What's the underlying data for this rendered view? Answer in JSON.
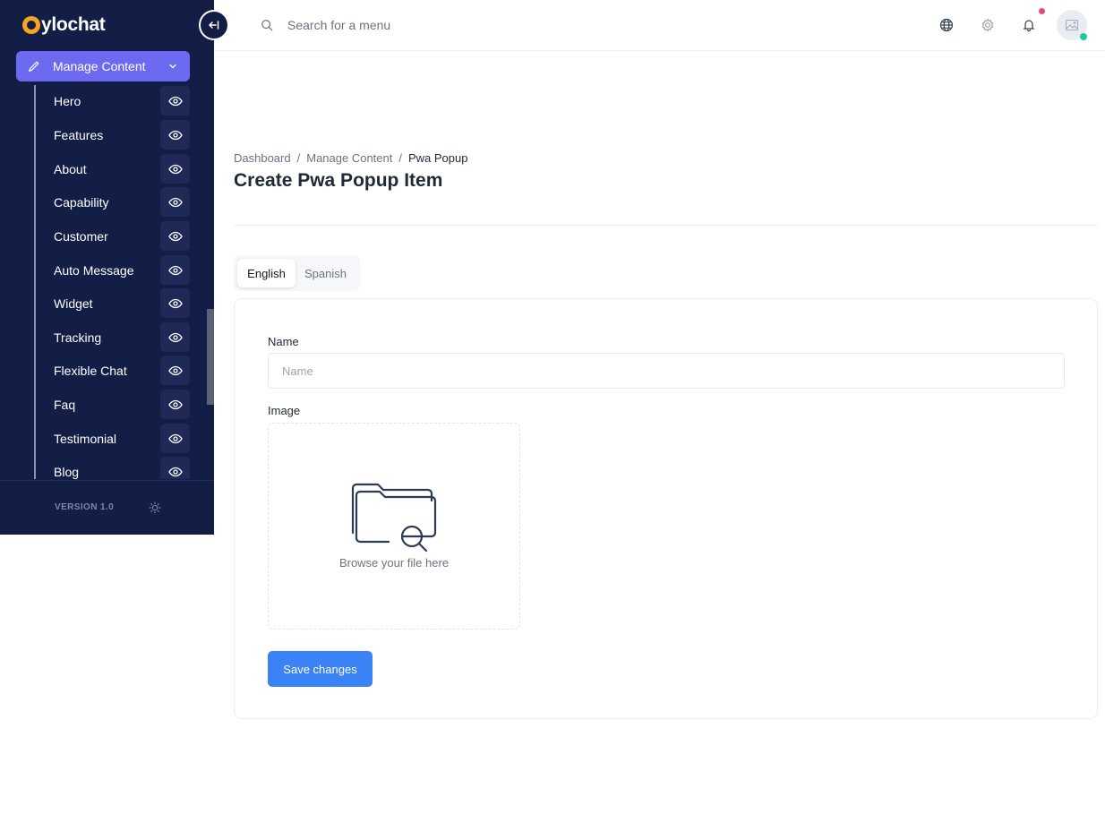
{
  "brand": {
    "name": "ylochat"
  },
  "sidebar": {
    "parent": {
      "label": "Manage Content"
    },
    "items": [
      {
        "label": "Hero"
      },
      {
        "label": "Features"
      },
      {
        "label": "About"
      },
      {
        "label": "Capability"
      },
      {
        "label": "Customer"
      },
      {
        "label": "Auto Message"
      },
      {
        "label": "Widget"
      },
      {
        "label": "Tracking"
      },
      {
        "label": "Flexible Chat"
      },
      {
        "label": "Faq"
      },
      {
        "label": "Testimonial"
      },
      {
        "label": "Blog"
      }
    ],
    "version": "VERSION 1.0"
  },
  "topbar": {
    "search_placeholder": "Search for a menu",
    "icons": [
      "globe-icon",
      "gear-icon",
      "bell-icon",
      "avatar-image-icon"
    ],
    "colors": {
      "notification": "#e94b71",
      "online": "#1cc8a0"
    }
  },
  "breadcrumb": {
    "items": [
      "Dashboard",
      "Manage Content",
      "Pwa Popup"
    ],
    "separator": "/"
  },
  "page": {
    "title": "Create Pwa Popup Item"
  },
  "tabs": [
    {
      "label": "English",
      "active": true
    },
    {
      "label": "Spanish",
      "active": false
    }
  ],
  "form": {
    "name_label": "Name",
    "name_placeholder": "Name",
    "name_value": "",
    "image_label": "Image",
    "dropzone_text": "Browse your file here",
    "save_label": "Save changes"
  },
  "colors": {
    "sidebar": "#121e45",
    "accent": "#6d6af2",
    "primary": "#3b82f6"
  }
}
